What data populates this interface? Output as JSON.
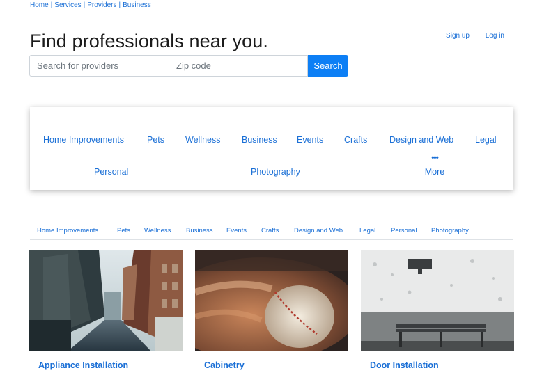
{
  "topnav": {
    "items": [
      "Home",
      "Services",
      "Providers",
      "Business"
    ],
    "separator": "|"
  },
  "auth": {
    "signup": "Sign up",
    "login": "Log in"
  },
  "hero": {
    "headline": "Find professionals near you."
  },
  "search": {
    "provider_placeholder": "Search for providers",
    "zip_placeholder": "Zip code",
    "button": "Search",
    "accent": "#0d7ff5"
  },
  "categories": {
    "row1": [
      "Home Improvements",
      "Pets",
      "Wellness",
      "Business",
      "Events",
      "Crafts",
      "Design and Web",
      "Legal"
    ],
    "row2": [
      "Personal",
      "Photography"
    ],
    "more_dots": "•••",
    "more": "More"
  },
  "subtabs": [
    "Home Improvements",
    "Pets",
    "Wellness",
    "Business",
    "Events",
    "Crafts",
    "Design and Web",
    "Legal",
    "Personal",
    "Photography"
  ],
  "cards": [
    {
      "title": "Appliance Installation",
      "image": "city-street-photo"
    },
    {
      "title": "Cabinetry",
      "image": "baseball-glove-photo"
    },
    {
      "title": "Door Installation",
      "image": "bench-wall-photo"
    }
  ],
  "colors": {
    "link": "#1a6fd6",
    "text": "#212529"
  }
}
